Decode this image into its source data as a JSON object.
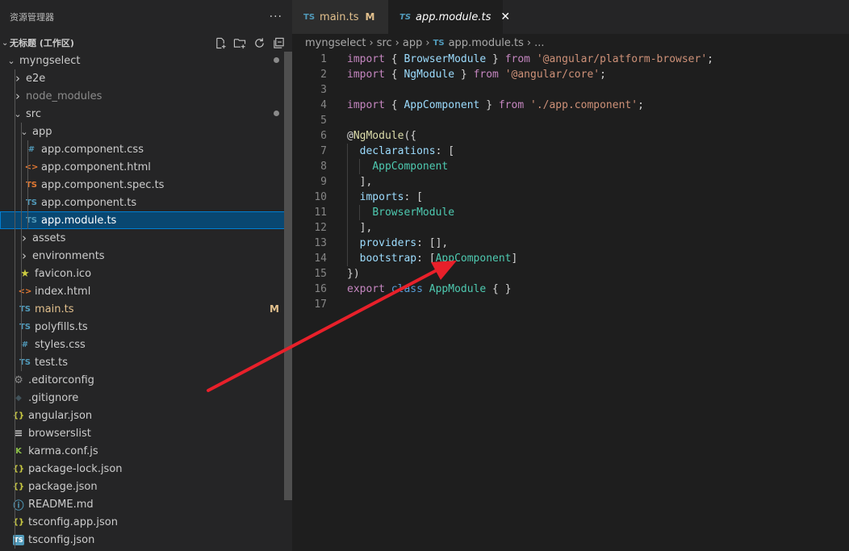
{
  "sidebar": {
    "title": "资源管理器",
    "more": "···",
    "workspace_title": "无标题 (工作区)"
  },
  "tree": [
    {
      "label": "myngselect",
      "kind": "folder-open",
      "depth": 0,
      "dot": true
    },
    {
      "label": "e2e",
      "kind": "folder",
      "depth": 1
    },
    {
      "label": "node_modules",
      "kind": "folder",
      "depth": 1,
      "dim": true
    },
    {
      "label": "src",
      "kind": "folder-open",
      "depth": 1,
      "dot": true
    },
    {
      "label": "app",
      "kind": "folder-open",
      "depth": 2
    },
    {
      "label": "app.component.css",
      "kind": "css",
      "depth": 3
    },
    {
      "label": "app.component.html",
      "kind": "html",
      "depth": 3
    },
    {
      "label": "app.component.spec.ts",
      "kind": "spec",
      "depth": 3
    },
    {
      "label": "app.component.ts",
      "kind": "ts",
      "depth": 3
    },
    {
      "label": "app.module.ts",
      "kind": "ts",
      "depth": 3,
      "selected": true
    },
    {
      "label": "assets",
      "kind": "folder",
      "depth": 2
    },
    {
      "label": "environments",
      "kind": "folder",
      "depth": 2
    },
    {
      "label": "favicon.ico",
      "kind": "star",
      "depth": 2
    },
    {
      "label": "index.html",
      "kind": "html",
      "depth": 2
    },
    {
      "label": "main.ts",
      "kind": "ts",
      "depth": 2,
      "modified": true,
      "badge": "M"
    },
    {
      "label": "polyfills.ts",
      "kind": "ts",
      "depth": 2
    },
    {
      "label": "styles.css",
      "kind": "css",
      "depth": 2
    },
    {
      "label": "test.ts",
      "kind": "ts",
      "depth": 2
    },
    {
      "label": ".editorconfig",
      "kind": "gear",
      "depth": 1
    },
    {
      "label": ".gitignore",
      "kind": "git",
      "depth": 1
    },
    {
      "label": "angular.json",
      "kind": "json",
      "depth": 1
    },
    {
      "label": "browserslist",
      "kind": "lines",
      "depth": 1
    },
    {
      "label": "karma.conf.js",
      "kind": "karma",
      "depth": 1
    },
    {
      "label": "package-lock.json",
      "kind": "json",
      "depth": 1
    },
    {
      "label": "package.json",
      "kind": "json",
      "depth": 1
    },
    {
      "label": "README.md",
      "kind": "info",
      "depth": 1
    },
    {
      "label": "tsconfig.app.json",
      "kind": "json",
      "depth": 1
    },
    {
      "label": "tsconfig.json",
      "kind": "tsbox",
      "depth": 1
    }
  ],
  "tabs": {
    "main": {
      "icon": "TS",
      "label": "main.ts",
      "status": "M"
    },
    "module": {
      "icon": "TS",
      "label": "app.module.ts",
      "close": "✕"
    }
  },
  "breadcrumb": {
    "parts": [
      "myngselect",
      "src",
      "app"
    ],
    "file_icon": "TS",
    "file": "app.module.ts",
    "tail": "...",
    "sep": "›"
  },
  "editor": {
    "lines": [
      {
        "n": "1",
        "indent": 0,
        "tokens": [
          [
            "kw",
            "import"
          ],
          [
            "p",
            " { "
          ],
          [
            "var",
            "BrowserModule"
          ],
          [
            "p",
            " } "
          ],
          [
            "kw",
            "from"
          ],
          [
            "p",
            " "
          ],
          [
            "str",
            "'@angular/platform-browser'"
          ],
          [
            "p",
            ";"
          ]
        ]
      },
      {
        "n": "2",
        "indent": 0,
        "tokens": [
          [
            "kw",
            "import"
          ],
          [
            "p",
            " { "
          ],
          [
            "var",
            "NgModule"
          ],
          [
            "p",
            " } "
          ],
          [
            "kw",
            "from"
          ],
          [
            "p",
            " "
          ],
          [
            "str",
            "'@angular/core'"
          ],
          [
            "p",
            ";"
          ]
        ]
      },
      {
        "n": "3",
        "indent": 0,
        "tokens": []
      },
      {
        "n": "4",
        "indent": 0,
        "tokens": [
          [
            "kw",
            "import"
          ],
          [
            "p",
            " { "
          ],
          [
            "var",
            "AppComponent"
          ],
          [
            "p",
            " } "
          ],
          [
            "kw",
            "from"
          ],
          [
            "p",
            " "
          ],
          [
            "str",
            "'./app.component'"
          ],
          [
            "p",
            ";"
          ]
        ]
      },
      {
        "n": "5",
        "indent": 0,
        "tokens": []
      },
      {
        "n": "6",
        "indent": 0,
        "tokens": [
          [
            "p",
            "@"
          ],
          [
            "fn",
            "NgModule"
          ],
          [
            "p",
            "({"
          ]
        ]
      },
      {
        "n": "7",
        "indent": 1,
        "tokens": [
          [
            "p",
            "  "
          ],
          [
            "var",
            "declarations"
          ],
          [
            "p",
            ": ["
          ]
        ]
      },
      {
        "n": "8",
        "indent": 2,
        "tokens": [
          [
            "p",
            "    "
          ],
          [
            "cls",
            "AppComponent"
          ]
        ]
      },
      {
        "n": "9",
        "indent": 1,
        "tokens": [
          [
            "p",
            "  ],"
          ]
        ]
      },
      {
        "n": "10",
        "indent": 1,
        "tokens": [
          [
            "p",
            "  "
          ],
          [
            "var",
            "imports"
          ],
          [
            "p",
            ": ["
          ]
        ]
      },
      {
        "n": "11",
        "indent": 2,
        "tokens": [
          [
            "p",
            "    "
          ],
          [
            "cls",
            "BrowserModule"
          ]
        ]
      },
      {
        "n": "12",
        "indent": 1,
        "tokens": [
          [
            "p",
            "  ],"
          ]
        ]
      },
      {
        "n": "13",
        "indent": 1,
        "tokens": [
          [
            "p",
            "  "
          ],
          [
            "var",
            "providers"
          ],
          [
            "p",
            ": [],"
          ]
        ]
      },
      {
        "n": "14",
        "indent": 1,
        "tokens": [
          [
            "p",
            "  "
          ],
          [
            "var",
            "bootstrap"
          ],
          [
            "p",
            ": ["
          ],
          [
            "cls",
            "AppComponent"
          ],
          [
            "p",
            "]"
          ]
        ]
      },
      {
        "n": "15",
        "indent": 0,
        "tokens": [
          [
            "p",
            "})"
          ]
        ]
      },
      {
        "n": "16",
        "indent": 0,
        "tokens": [
          [
            "kw",
            "export"
          ],
          [
            "p",
            " "
          ],
          [
            "kw2",
            "class"
          ],
          [
            "p",
            " "
          ],
          [
            "cls",
            "AppModule"
          ],
          [
            "p",
            " { }"
          ]
        ]
      },
      {
        "n": "17",
        "indent": 0,
        "tokens": []
      }
    ]
  },
  "colors": {
    "annotation_arrow": "#e8202a"
  }
}
